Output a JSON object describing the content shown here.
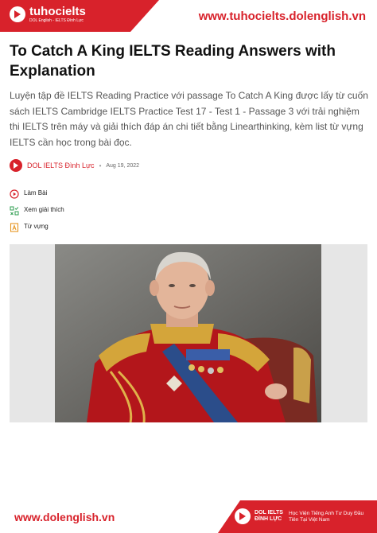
{
  "header": {
    "logo_name": "tuhocielts",
    "logo_sub": "DOL English - IELTS Đình Lực",
    "url": "www.tuhocielts.dolenglish.vn"
  },
  "article": {
    "title": "To Catch A King IELTS Reading Answers with Explanation",
    "description": "Luyện tập đề IELTS Reading Practice với passage To Catch A King được lấy từ cuốn sách IELTS Cambridge IELTS Practice Test 17  - Test 1  - Passage 3 với trải nghiệm thi IELTS trên máy và giải thích đáp án chi tiết bằng Linearthinking, kèm list từ vựng IELTS cần học trong bài đọc.",
    "author": "DOL IELTS Đình Lực",
    "separator": "•",
    "date": "Aug 19,  2022"
  },
  "toc": [
    {
      "icon": "play-circle-icon",
      "label": "Làm Bài"
    },
    {
      "icon": "grid-check-icon",
      "label": "Xem giải thích"
    },
    {
      "icon": "document-a-icon",
      "label": "Từ vựng"
    }
  ],
  "footer": {
    "url": "www.dolenglish.vn",
    "brand": "DOL IELTS ĐÌNH LỰC",
    "tagline": "Học Viện Tiếng Anh Tư Duy Đầu Tiên Tại Việt Nam"
  },
  "colors": {
    "brand_red": "#d8222b",
    "text_gray": "#555555"
  }
}
